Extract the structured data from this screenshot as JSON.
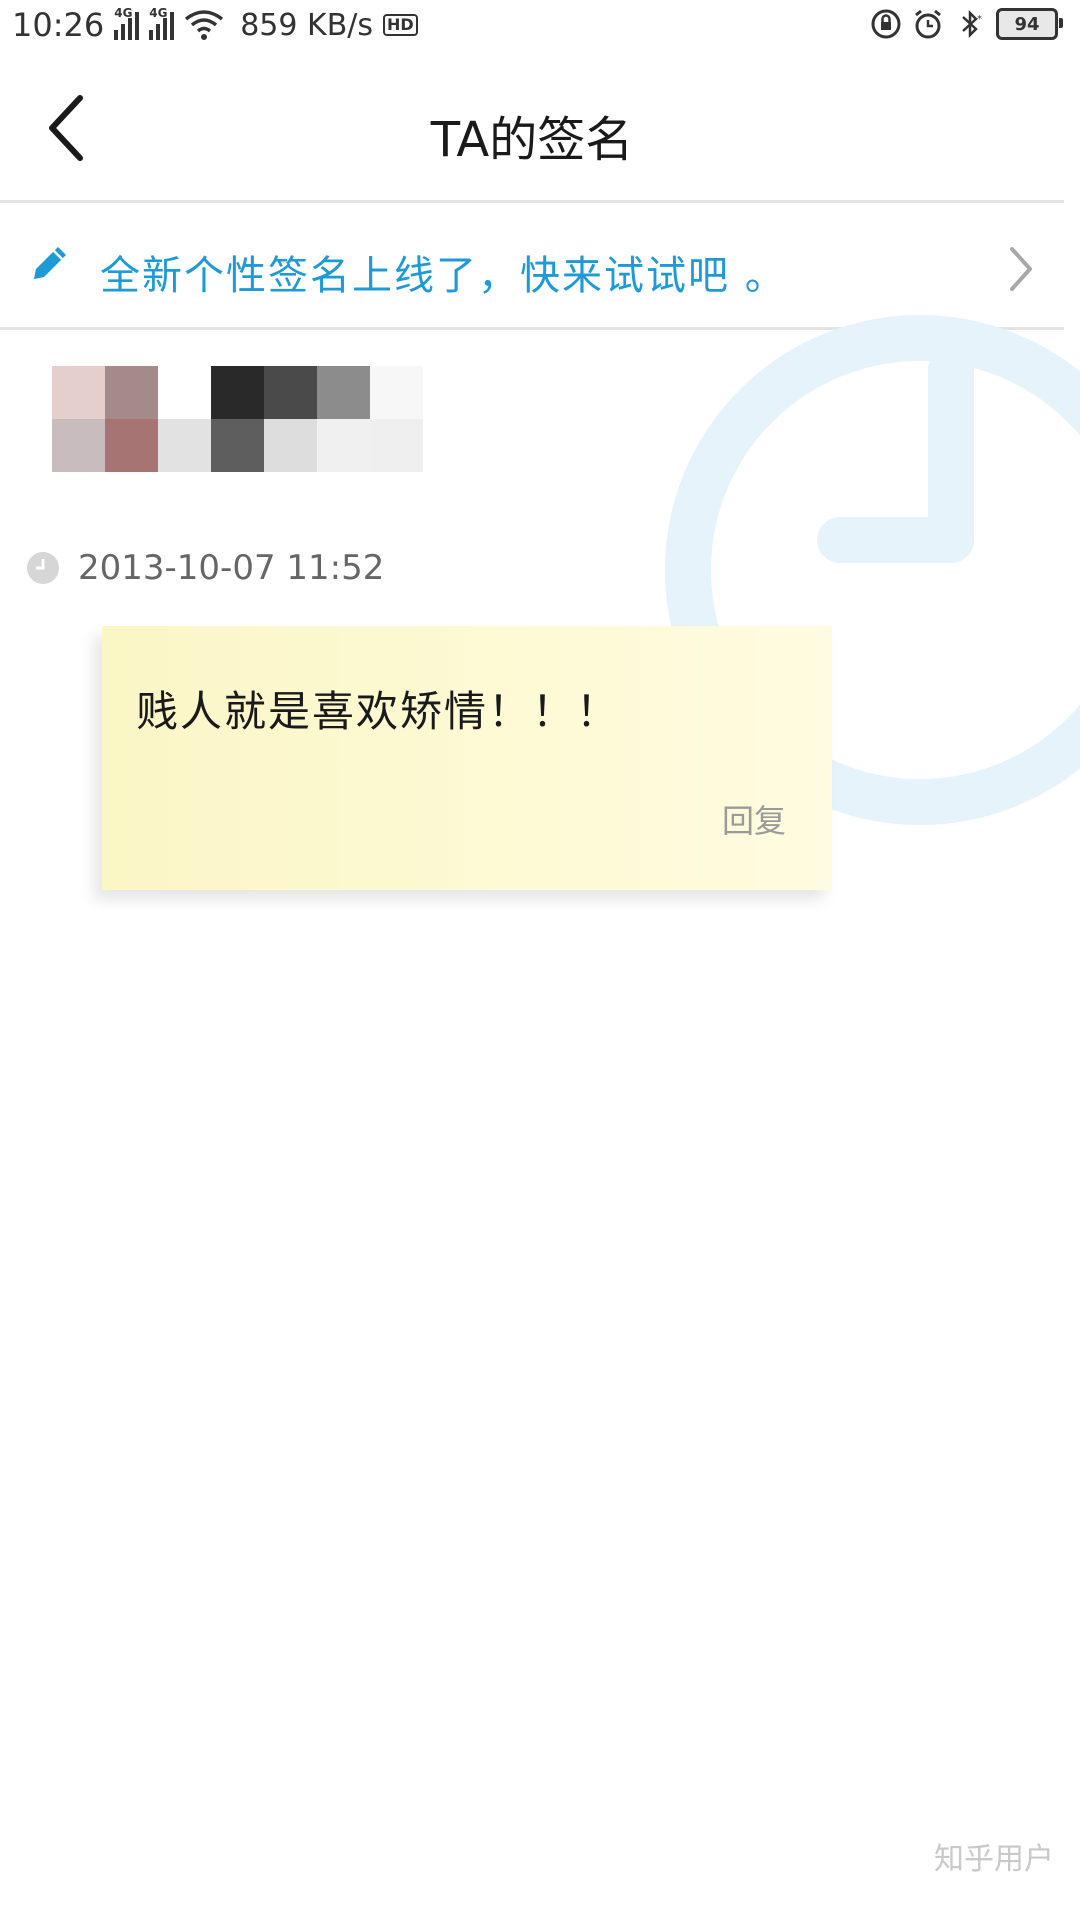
{
  "status_bar": {
    "time": "10:26",
    "network_1": "4G",
    "network_2": "4G",
    "speed": "859 KB/s",
    "hd_label": "HD",
    "battery": "94",
    "icons": [
      "signal-icon",
      "wifi-icon",
      "hd-icon",
      "lock-rotation-icon",
      "alarm-icon",
      "bluetooth-icon",
      "battery-icon"
    ]
  },
  "header": {
    "title": "TA的签名",
    "back_icon": "chevron-left-icon"
  },
  "promo": {
    "text": "全新个性签名上线了，快来试试吧 。",
    "icon": "pencil-icon",
    "chevron": "chevron-right-icon",
    "accent_color": "#1e9ad6"
  },
  "signature": {
    "timestamp": "2013-10-07 11:52",
    "text": "贱人就是喜欢矫情！！！",
    "reply_label": "回复"
  },
  "watermark": "知乎用户"
}
